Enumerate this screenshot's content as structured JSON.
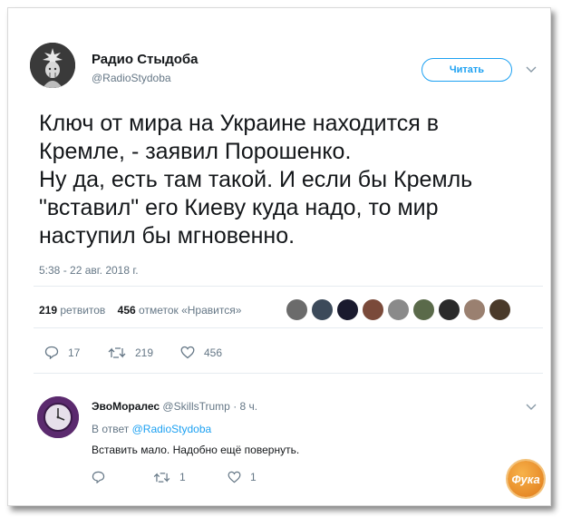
{
  "tweet": {
    "author_name": "Радио Стыдоба",
    "author_handle": "@RadioStydoba",
    "follow_label": "Читать",
    "text_lines": [
      "Ключ от мира на Украине находится в",
      "Кремле, - заявил Порошенко.",
      "Ну да, есть там такой. И если бы Кремль",
      "\"вставил\" его Киеву куда надо, то мир",
      "наступил бы мгновенно."
    ],
    "timestamp": "5:38 - 22 авг. 2018 г.",
    "retweets_count": "219",
    "retweets_label": "ретвитов",
    "likes_count": "456",
    "likes_label": "отметок «Нравится»",
    "actions": {
      "replies": "17",
      "retweets": "219",
      "likes": "456"
    }
  },
  "reply": {
    "author_name": "ЭвоМоралес",
    "author_handle": "@SkillsTrump",
    "time": "· 8 ч.",
    "in_reply_prefix": "В ответ",
    "in_reply_handle": "@RadioStydoba",
    "text": "Вставить мало. Надобно ещё повернуть.",
    "actions": {
      "replies": "",
      "retweets": "1",
      "likes": "1"
    }
  },
  "watermark": {
    "text": "Фука"
  },
  "colors": {
    "accent": "#1da1f2",
    "text": "#14171a",
    "muted": "#657786",
    "divider": "#e6ecf0"
  }
}
